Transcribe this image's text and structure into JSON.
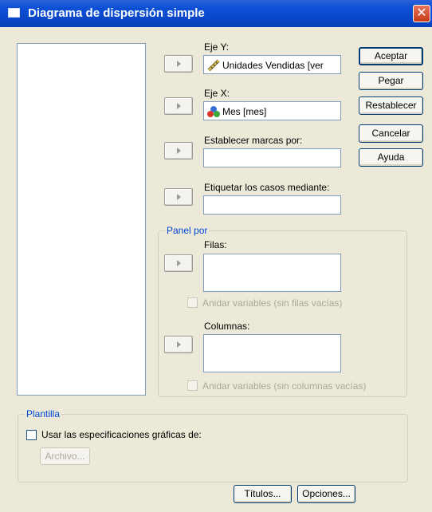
{
  "dialog": {
    "title": "Diagrama de dispersión simple",
    "close_glyph": "✕"
  },
  "targets": {
    "y_axis": {
      "label": "Eje Y:",
      "value": "Unidades Vendidas [ver",
      "icon": "ruler-scale-icon"
    },
    "x_axis": {
      "label": "Eje X:",
      "value": "Mes [mes]",
      "icon": "nominal-balls-icon"
    },
    "markers": {
      "label": "Establecer marcas por:",
      "value": ""
    },
    "case_labels": {
      "label": "Etiquetar los casos mediante:",
      "value": ""
    }
  },
  "panel": {
    "title": "Panel por",
    "rows_label": "Filas:",
    "rows_nest": "Anidar variables (sin filas vacías)",
    "cols_label": "Columnas:",
    "cols_nest": "Anidar variables (sin columnas vacías)"
  },
  "template": {
    "title": "Plantilla",
    "use_spec": "Usar las especificaciones gráficas de:",
    "file_button": "Archivo..."
  },
  "buttons": {
    "accept": "Aceptar",
    "paste": "Pegar",
    "reset": "Restablecer",
    "cancel": "Cancelar",
    "help": "Ayuda",
    "titles": "Títulos...",
    "options": "Opciones..."
  },
  "colors": {
    "titlebar": "#0a47c8",
    "dialog_bg": "#ece9d8",
    "group_title": "#0046d5",
    "disabled_text": "#aca899"
  }
}
